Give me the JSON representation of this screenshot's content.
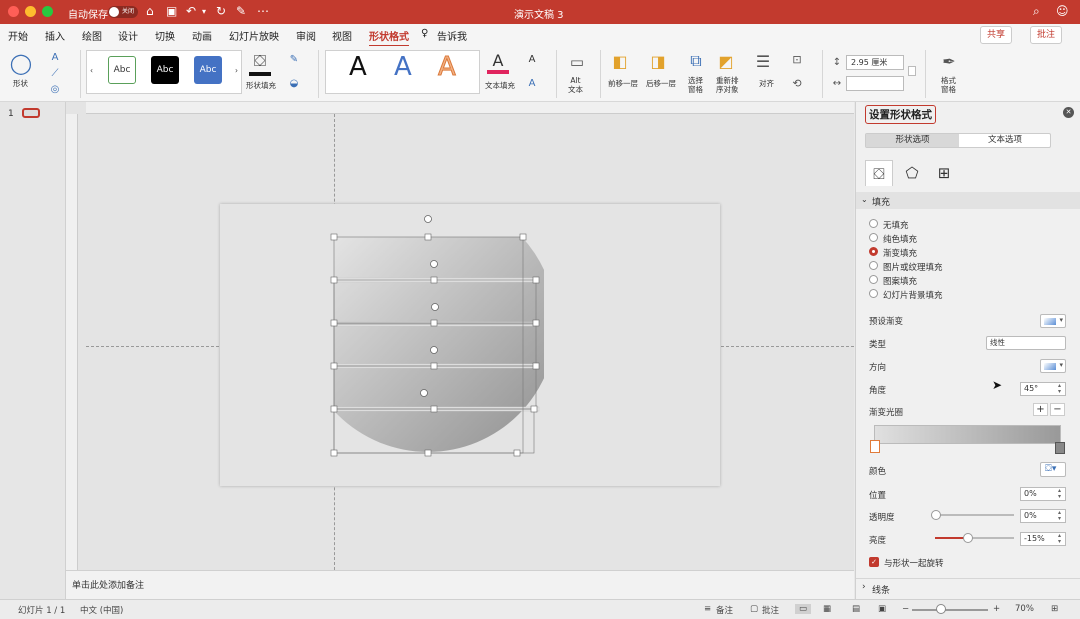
{
  "titlebar": {
    "autosave_label": "自动保存",
    "autosave_state": "关闭",
    "doc_title": "演示文稿 3"
  },
  "tabs": [
    "开始",
    "插入",
    "绘图",
    "设计",
    "切换",
    "动画",
    "幻灯片放映",
    "审阅",
    "视图",
    "形状格式"
  ],
  "tell_me": "告诉我",
  "share_label": "共享",
  "comments_label": "批注",
  "ribbon": {
    "shape_label": "形状",
    "style_labels": [
      "Abc",
      "Abc",
      "Abc"
    ],
    "shape_fill_label": "形状填充",
    "text_fill_label": "文本填充",
    "alt_text_label": "Alt\n文本",
    "bring_forward_label": "前移一层",
    "send_backward_label": "后移一层",
    "selection_pane_label": "选择\n窗格",
    "reorder_label": "重新排\n序对象",
    "align_label": "对齐",
    "height_value": "2.95 厘米",
    "width_value": "",
    "format_pane_label": "格式\n窗格",
    "wordart_letter": "A"
  },
  "thumbnail": {
    "number": "1"
  },
  "notes_placeholder": "单击此处添加备注",
  "status": {
    "slide_info": "幻灯片 1 / 1",
    "language": "中文 (中国)",
    "notes_btn": "备注",
    "comments_btn": "批注",
    "zoom": "70%"
  },
  "format_panel": {
    "title": "设置形状格式",
    "tab_shape": "形状选项",
    "tab_text": "文本选项",
    "fill_section": "填充",
    "fill_options": [
      "无填充",
      "纯色填充",
      "渐变填充",
      "图片或纹理填充",
      "图案填充",
      "幻灯片背景填充"
    ],
    "selected_fill": 2,
    "preset_gradient_label": "预设渐变",
    "type_label": "类型",
    "type_value": "线性",
    "direction_label": "方向",
    "angle_label": "角度",
    "angle_value": "45°",
    "gradient_stops_label": "渐变光圈",
    "color_label": "颜色",
    "position_label": "位置",
    "position_value": "0%",
    "transparency_label": "透明度",
    "transparency_value": "0%",
    "brightness_label": "亮度",
    "brightness_value": "-15%",
    "transparency_level": 0,
    "brightness_level": -0.15,
    "rotate_with_shape_label": "与形状一起旋转",
    "rotate_with_shape_checked": true,
    "line_section": "线条"
  },
  "colors": {
    "accent": "#c23a2e"
  }
}
